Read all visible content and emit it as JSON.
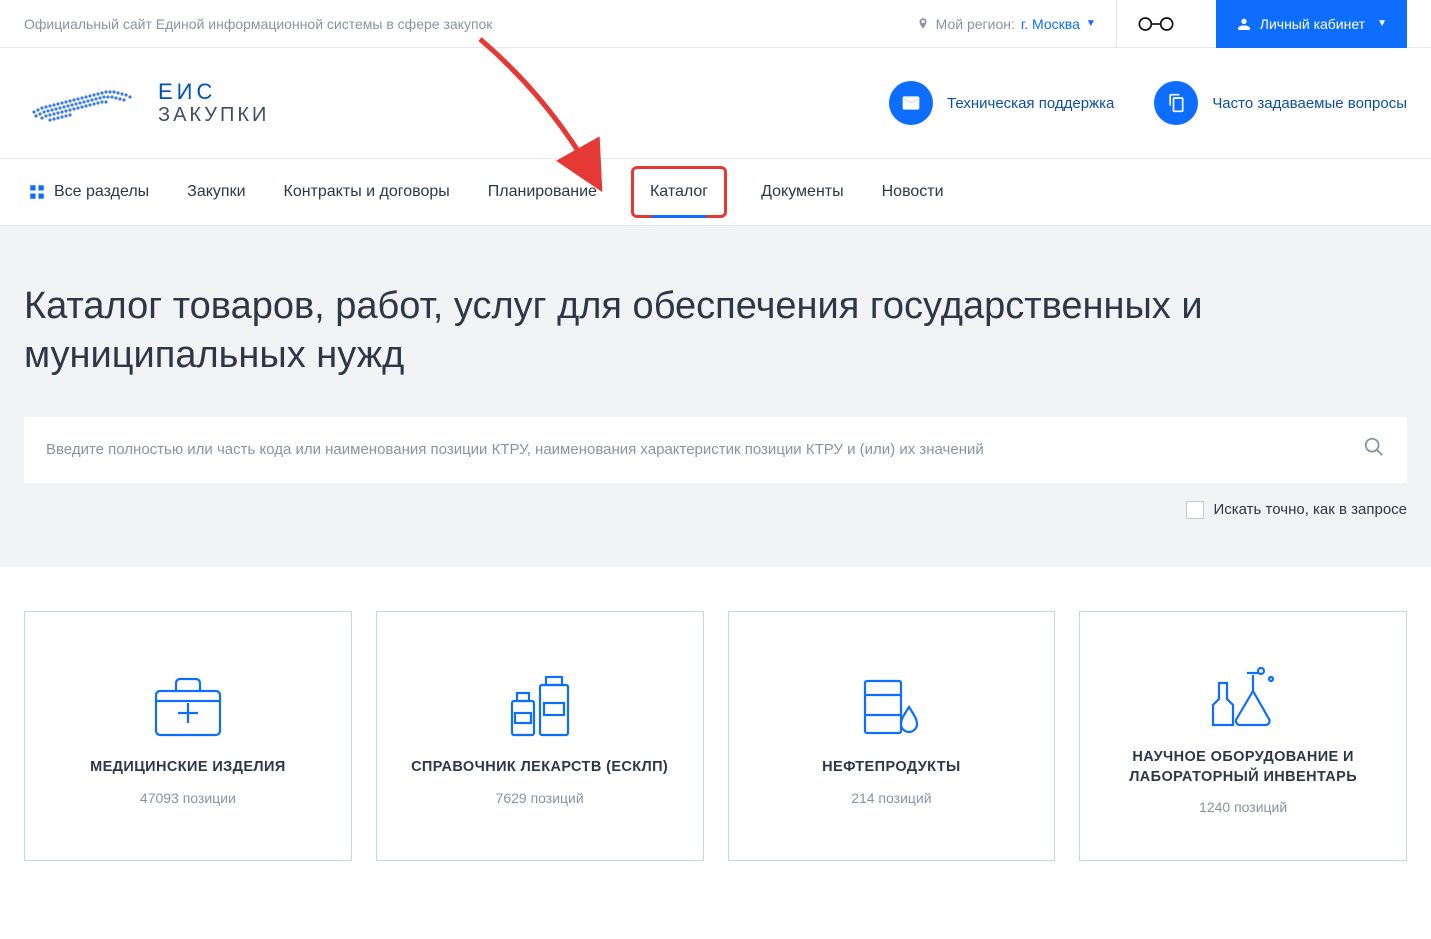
{
  "topbar": {
    "site_title": "Официальный сайт Единой информационной системы в сфере закупок",
    "region_label": "Мой регион:",
    "region_value": "г. Москва",
    "lk_label": "Личный кабинет"
  },
  "logo": {
    "line1": "ЕИС",
    "line2": "ЗАКУПКИ"
  },
  "header_links": {
    "support": "Техническая поддержка",
    "faq": "Часто задаваемые вопросы"
  },
  "nav": {
    "all": "Все разделы",
    "items": [
      "Закупки",
      "Контракты и договоры",
      "Планирование",
      "Каталог",
      "Документы",
      "Новости"
    ]
  },
  "hero": {
    "title": "Каталог товаров, работ, услуг для обеспечения государственных и муниципальных нужд",
    "search_placeholder": "Введите полностью или часть кода или наименования позиции КТРУ, наименования характеристик позиции КТРУ и (или) их значений",
    "exact_label": "Искать точно, как в запросе"
  },
  "cards": [
    {
      "title": "МЕДИЦИНСКИЕ ИЗДЕЛИЯ",
      "sub": "47093 позиции"
    },
    {
      "title": "СПРАВОЧНИК ЛЕКАРСТВ (ЕСКЛП)",
      "sub": "7629 позиций"
    },
    {
      "title": "НЕФТЕПРОДУКТЫ",
      "sub": "214 позиций"
    },
    {
      "title": "НАУЧНОЕ ОБОРУДОВАНИЕ И ЛАБОРАТОРНЫЙ ИНВЕНТАРЬ",
      "sub": "1240 позиций"
    }
  ]
}
